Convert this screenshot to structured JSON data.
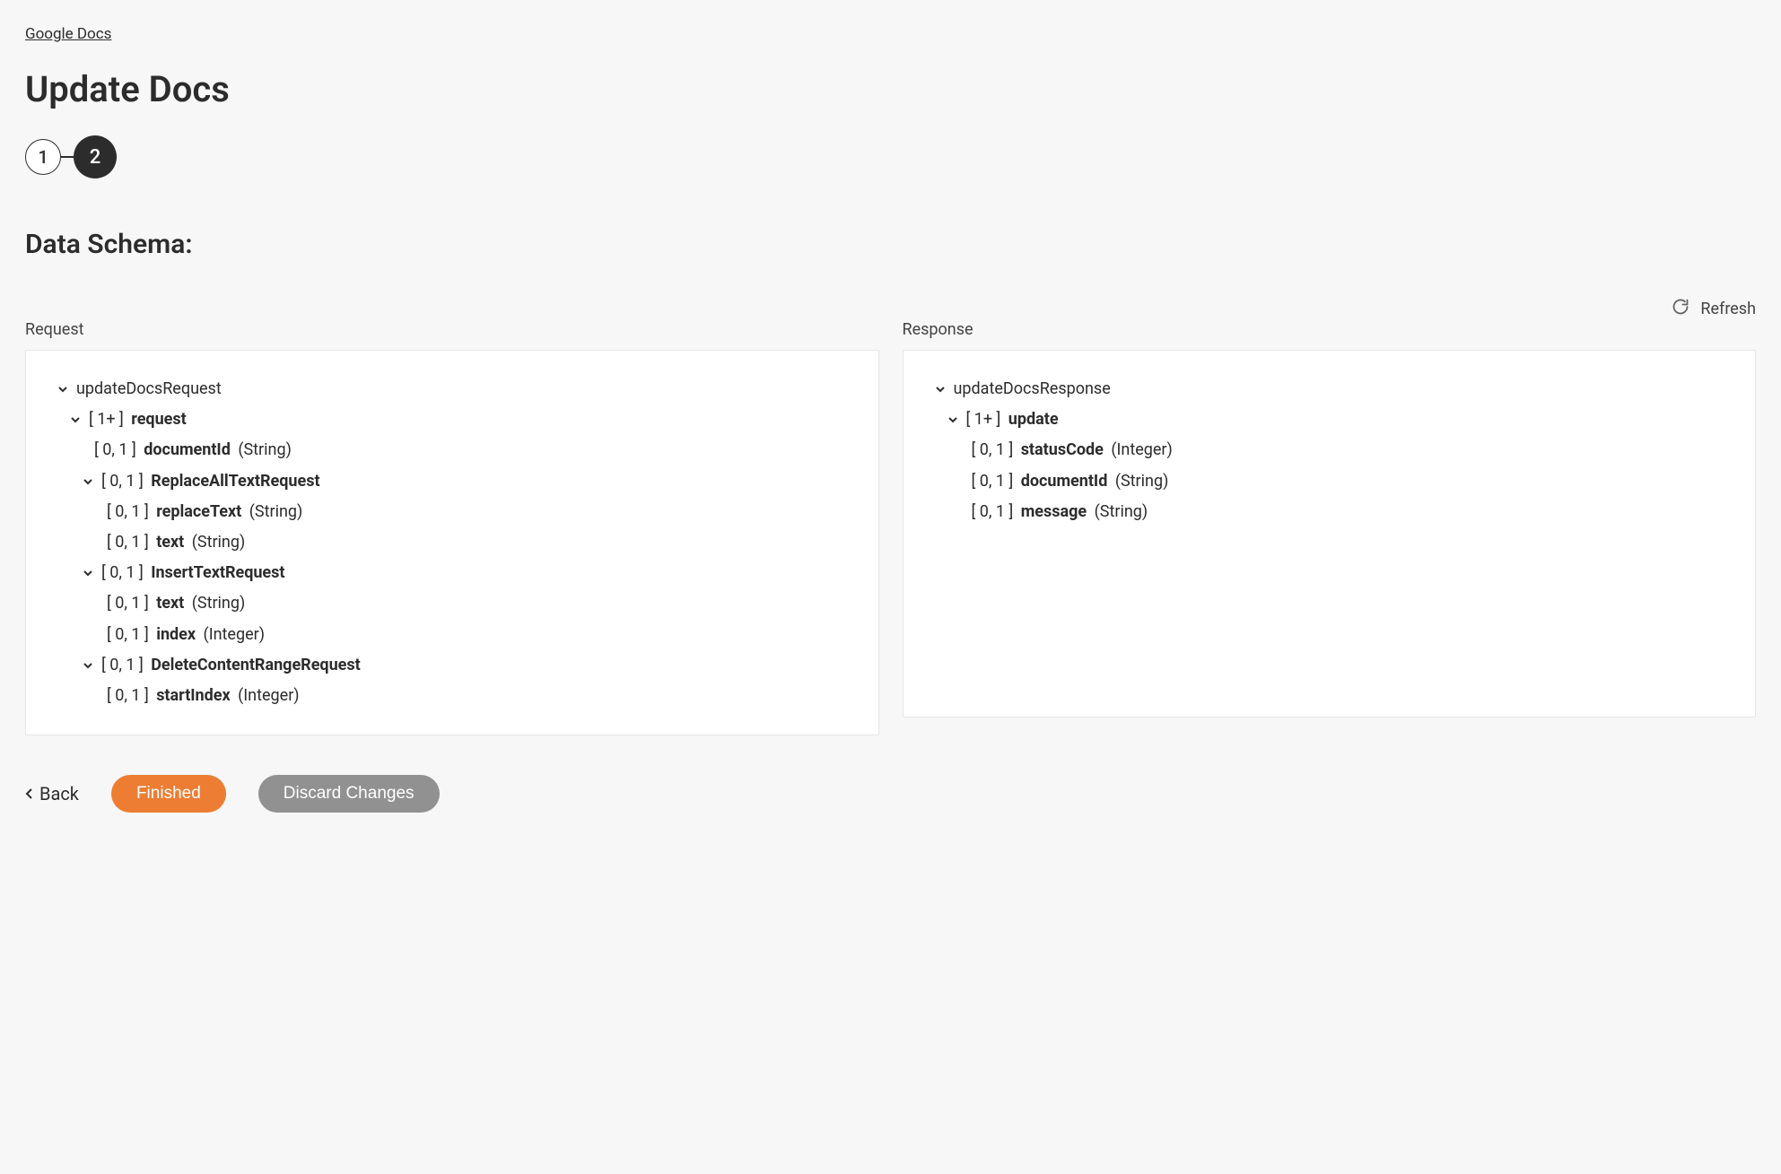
{
  "breadcrumb": "Google Docs",
  "page_title": "Update Docs",
  "stepper": {
    "step1": "1",
    "step2": "2"
  },
  "section_title": "Data Schema:",
  "refresh_label": "Refresh",
  "columns": {
    "request_header": "Request",
    "response_header": "Response"
  },
  "request_tree": {
    "root": "updateDocsRequest",
    "request": {
      "bracket": "[ 1+ ]",
      "name": "request"
    },
    "documentId": {
      "bracket": "[ 0, 1 ]",
      "name": "documentId",
      "type": "(String)"
    },
    "replaceAll": {
      "bracket": "[ 0, 1 ]",
      "name": "ReplaceAllTextRequest"
    },
    "replaceText": {
      "bracket": "[ 0, 1 ]",
      "name": "replaceText",
      "type": "(String)"
    },
    "text1": {
      "bracket": "[ 0, 1 ]",
      "name": "text",
      "type": "(String)"
    },
    "insertText": {
      "bracket": "[ 0, 1 ]",
      "name": "InsertTextRequest"
    },
    "text2": {
      "bracket": "[ 0, 1 ]",
      "name": "text",
      "type": "(String)"
    },
    "index": {
      "bracket": "[ 0, 1 ]",
      "name": "index",
      "type": "(Integer)"
    },
    "deleteRange": {
      "bracket": "[ 0, 1 ]",
      "name": "DeleteContentRangeRequest"
    },
    "startIndex": {
      "bracket": "[ 0, 1 ]",
      "name": "startIndex",
      "type": "(Integer)"
    }
  },
  "response_tree": {
    "root": "updateDocsResponse",
    "update": {
      "bracket": "[ 1+ ]",
      "name": "update"
    },
    "statusCode": {
      "bracket": "[ 0, 1 ]",
      "name": "statusCode",
      "type": "(Integer)"
    },
    "documentId": {
      "bracket": "[ 0, 1 ]",
      "name": "documentId",
      "type": "(String)"
    },
    "message": {
      "bracket": "[ 0, 1 ]",
      "name": "message",
      "type": "(String)"
    }
  },
  "footer": {
    "back": "Back",
    "finished": "Finished",
    "discard": "Discard Changes"
  }
}
